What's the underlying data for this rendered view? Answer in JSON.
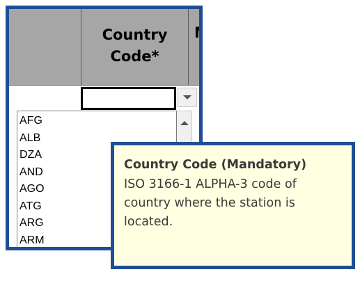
{
  "sheet": {
    "column_header": "Country Code*",
    "next_column_header_partial": "M",
    "selected_cell_value": ""
  },
  "dropdown": {
    "options": [
      "AFG",
      "ALB",
      "DZA",
      "AND",
      "AGO",
      "ATG",
      "ARG",
      "ARM"
    ]
  },
  "tooltip": {
    "title": "Country Code (Mandatory)",
    "body": "ISO 3166-1 ALPHA-3 code of country where the station is located."
  },
  "colors": {
    "frame": "#1f4e96",
    "header_bg": "#a6a6a6",
    "tooltip_bg": "#ffffe1"
  }
}
